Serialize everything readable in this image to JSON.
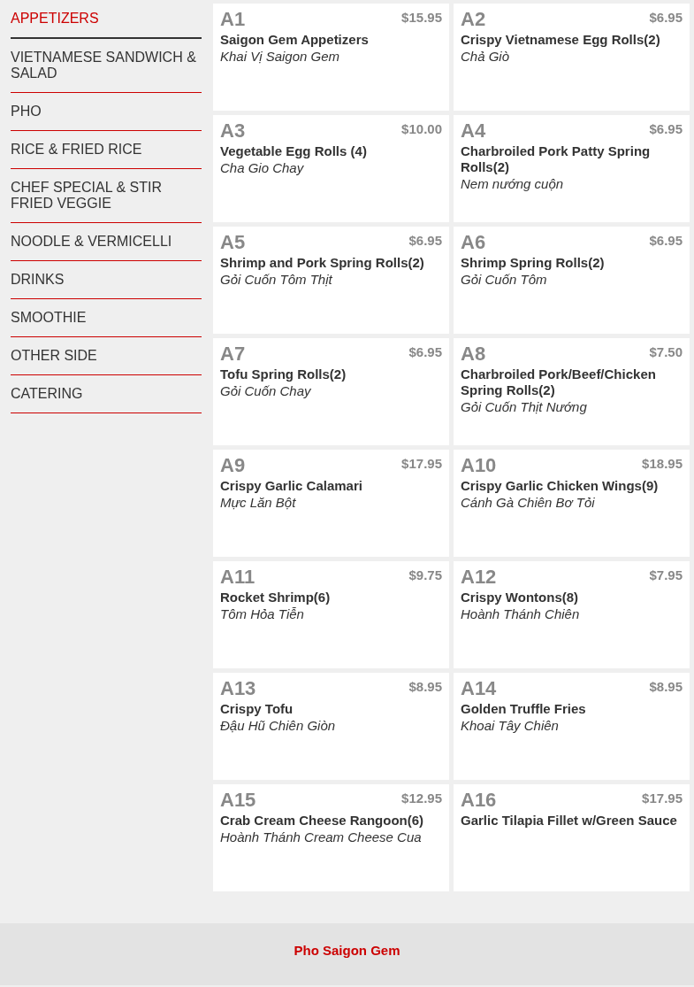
{
  "categories": [
    {
      "label": "APPETIZERS",
      "selected": true
    },
    {
      "label": "VIETNAMESE SANDWICH & SALAD",
      "selected": false
    },
    {
      "label": "PHO",
      "selected": false
    },
    {
      "label": "RICE & FRIED RICE",
      "selected": false
    },
    {
      "label": "CHEF SPECIAL & STIR FRIED VEGGIE",
      "selected": false
    },
    {
      "label": "NOODLE & VERMICELLI",
      "selected": false
    },
    {
      "label": "DRINKS",
      "selected": false
    },
    {
      "label": "SMOOTHIE",
      "selected": false
    },
    {
      "label": "OTHER SIDE",
      "selected": false
    },
    {
      "label": "CATERING",
      "selected": false
    }
  ],
  "menu_items": [
    {
      "code": "A1",
      "price": "$15.95",
      "name": "Saigon Gem Appetizers",
      "vietnamese_name": "Khai Vị Saigon Gem"
    },
    {
      "code": "A2",
      "price": "$6.95",
      "name": "Crispy Vietnamese Egg Rolls(2)",
      "vietnamese_name": "Chả Giò"
    },
    {
      "code": "A3",
      "price": "$10.00",
      "name": "Vegetable Egg Rolls (4)",
      "vietnamese_name": "Cha Gio Chay"
    },
    {
      "code": "A4",
      "price": "$6.95",
      "name": "Charbroiled Pork Patty Spring Rolls(2)",
      "vietnamese_name": "Nem nướng cuộn"
    },
    {
      "code": "A5",
      "price": "$6.95",
      "name": "Shrimp and Pork Spring Rolls(2)",
      "vietnamese_name": "Gỏi Cuốn Tôm Thịt"
    },
    {
      "code": "A6",
      "price": "$6.95",
      "name": "Shrimp Spring Rolls(2)",
      "vietnamese_name": "Gỏi Cuốn Tôm"
    },
    {
      "code": "A7",
      "price": "$6.95",
      "name": "Tofu Spring Rolls(2)",
      "vietnamese_name": "Gỏi Cuốn Chay"
    },
    {
      "code": "A8",
      "price": "$7.50",
      "name": "Charbroiled Pork/Beef/Chicken Spring Rolls(2)",
      "vietnamese_name": "Gỏi Cuốn Thịt Nướng"
    },
    {
      "code": "A9",
      "price": "$17.95",
      "name": "Crispy Garlic Calamari",
      "vietnamese_name": "Mực Lăn Bột"
    },
    {
      "code": "A10",
      "price": "$18.95",
      "name": "Crispy Garlic Chicken Wings(9)",
      "vietnamese_name": "Cánh Gà Chiên Bơ Tỏi"
    },
    {
      "code": "A11",
      "price": "$9.75",
      "name": "Rocket Shrimp(6)",
      "vietnamese_name": "Tôm Hỏa Tiễn"
    },
    {
      "code": "A12",
      "price": "$7.95",
      "name": "Crispy Wontons(8)",
      "vietnamese_name": "Hoành Thánh Chiên"
    },
    {
      "code": "A13",
      "price": "$8.95",
      "name": "Crispy Tofu",
      "vietnamese_name": "Đậu Hũ Chiên Giòn"
    },
    {
      "code": "A14",
      "price": "$8.95",
      "name": "Golden Truffle Fries",
      "vietnamese_name": "Khoai Tây Chiên"
    },
    {
      "code": "A15",
      "price": "$12.95",
      "name": "Crab Cream Cheese Rangoon(6)",
      "vietnamese_name": "Hoành Thánh Cream Cheese Cua"
    },
    {
      "code": "A16",
      "price": "$17.95",
      "name": "Garlic Tilapia Fillet w/Green Sauce"
    }
  ],
  "footer": {
    "title": "Pho Saigon Gem"
  }
}
